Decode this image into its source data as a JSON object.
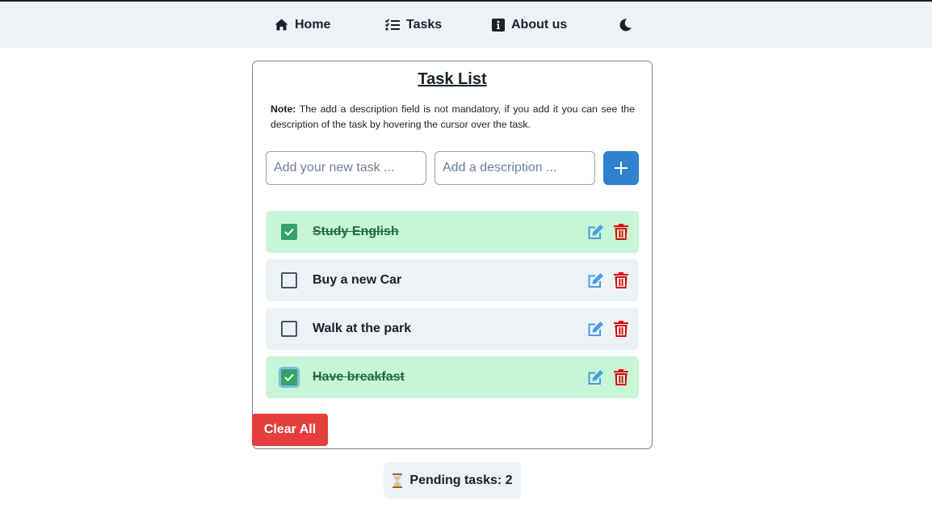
{
  "nav": {
    "home": {
      "label": "Home",
      "icon": "home-icon"
    },
    "tasks": {
      "label": "Tasks",
      "icon": "tasks-icon"
    },
    "about": {
      "label": "About us",
      "icon": "info-icon"
    },
    "theme_toggle": {
      "icon": "moon-icon"
    }
  },
  "main": {
    "title": "Task List",
    "note_label": "Note:",
    "note_text": " The add a description field is not mandatory, if you add it you can see the description of the task by hovering the cursor over the task.",
    "task_input": {
      "placeholder": "Add your new task ...",
      "value": ""
    },
    "description_input": {
      "placeholder": "Add a description ...",
      "value": ""
    },
    "add_button_icon": "plus-icon",
    "tasks": [
      {
        "label": "Study English",
        "completed": true
      },
      {
        "label": "Buy a new Car",
        "completed": false
      },
      {
        "label": "Walk at the park",
        "completed": false
      },
      {
        "label": "Have breakfast",
        "completed": true
      }
    ],
    "clear_all_label": "Clear All"
  },
  "footer": {
    "pending_icon": "hourglass-icon",
    "pending_label": "Pending tasks: 2"
  },
  "colors": {
    "accent": "#3182ce",
    "danger": "#e53e3e",
    "done_bg": "#c6f6d5",
    "done_check": "#38a169",
    "nav_bg": "#edf2f7"
  }
}
